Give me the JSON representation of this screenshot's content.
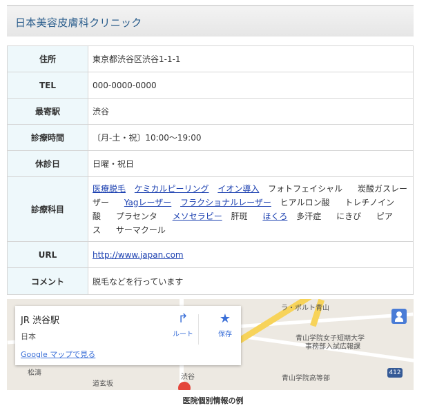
{
  "clinic_name": "日本美容皮膚科クリニック",
  "info": {
    "address_label": "住所",
    "address_value": "東京都渋谷区渋谷1-1-1",
    "tel_label": "TEL",
    "tel_value": "000-0000-0000",
    "station_label": "最寄駅",
    "station_value": "渋谷",
    "hours_label": "診療時間",
    "hours_value": "〔月-土・祝〕10:00〜19:00",
    "closed_label": "休診日",
    "closed_value": "日曜・祝日",
    "subjects_label": "診療科目",
    "subjects": [
      {
        "text": "医療脱毛",
        "link": true
      },
      {
        "text": "ケミカルピーリング",
        "link": true
      },
      {
        "text": "イオン導入",
        "link": true
      },
      {
        "text": "フォトフェイシャル",
        "link": false
      },
      {
        "text": "炭酸ガスレーザー",
        "link": false
      },
      {
        "text": "Yagレーザー",
        "link": true
      },
      {
        "text": "フラクショナルレーザー",
        "link": true
      },
      {
        "text": "ヒアルロン酸",
        "link": false
      },
      {
        "text": "トレチノイン酸",
        "link": false
      },
      {
        "text": "プラセンタ",
        "link": false
      },
      {
        "text": "メソセラピー",
        "link": true
      },
      {
        "text": "肝斑",
        "link": false
      },
      {
        "text": "ほくろ",
        "link": true
      },
      {
        "text": "多汗症",
        "link": false
      },
      {
        "text": "にきび",
        "link": false
      },
      {
        "text": "ピアス",
        "link": false
      },
      {
        "text": "サーマクール",
        "link": false
      }
    ],
    "url_label": "URL",
    "url_value": "http://www.japan.com",
    "comment_label": "コメント",
    "comment_value": "脱毛などを行っています"
  },
  "map": {
    "place_name": "JR 渋谷駅",
    "country": "日本",
    "open_in_google_maps": "Google マップで見る",
    "route_label": "ルート",
    "save_label": "保存",
    "labels": {
      "la_porte": "ラ・ポルト青山",
      "college": "青山学院女子短期大学",
      "office": "事務部入試広報課",
      "highschool": "青山学院高等部",
      "matsuno": "松濤",
      "dogenzaka": "道玄坂",
      "shibuya": "渋谷",
      "route_no": "412"
    },
    "icons": {
      "route": "directions-icon",
      "save": "star-icon",
      "street_view": "pegman-icon",
      "pin": "map-pin-icon"
    }
  },
  "caption": "医院個別情報の例",
  "colors": {
    "title": "#2a5d8c",
    "header_bg": "#eef8fb",
    "link": "#1a3fb0"
  }
}
